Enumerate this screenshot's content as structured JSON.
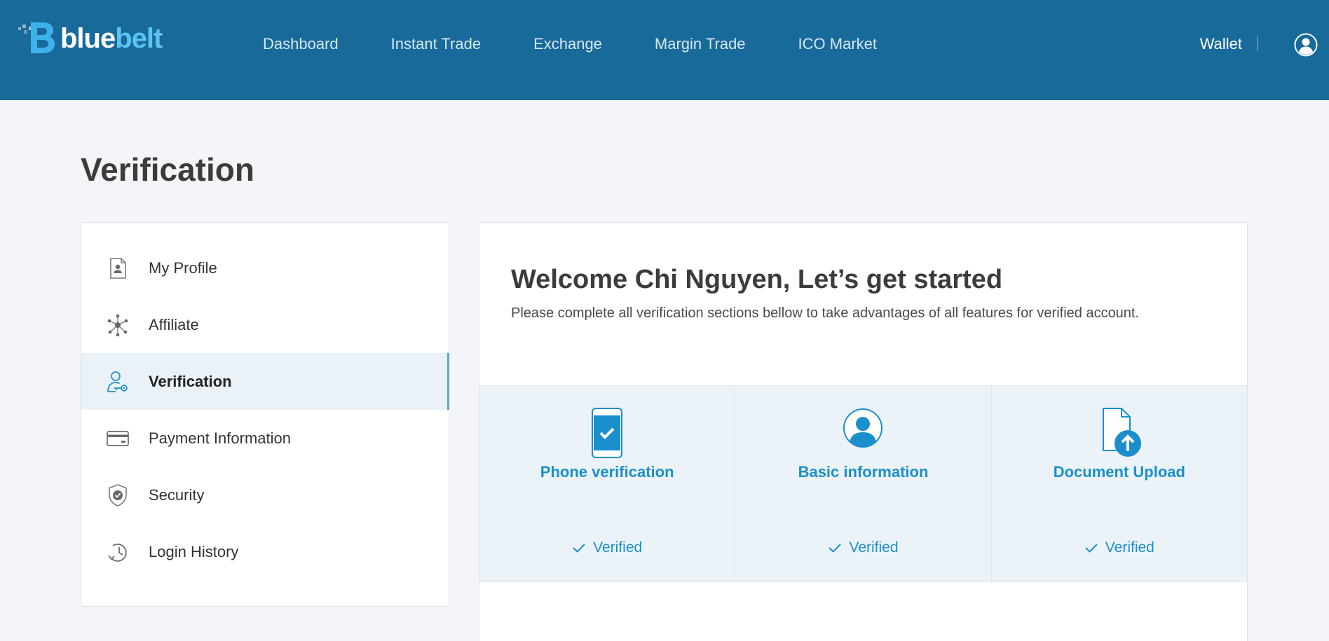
{
  "header": {
    "logo": {
      "word_white": "blue",
      "word_blue": "belt"
    },
    "nav": [
      {
        "label": "Dashboard"
      },
      {
        "label": "Instant Trade"
      },
      {
        "label": "Exchange"
      },
      {
        "label": "Margin Trade"
      },
      {
        "label": "ICO Market"
      }
    ],
    "wallet_label": "Wallet",
    "user_icon": "user-circle-icon"
  },
  "page_title": "Verification",
  "sidebar": {
    "items": [
      {
        "label": "My Profile",
        "icon": "profile-document-icon",
        "active": false
      },
      {
        "label": "Affiliate",
        "icon": "network-icon",
        "active": false
      },
      {
        "label": "Verification",
        "icon": "user-key-icon",
        "active": true
      },
      {
        "label": "Payment Information",
        "icon": "credit-card-icon",
        "active": false
      },
      {
        "label": "Security",
        "icon": "shield-check-icon",
        "active": false
      },
      {
        "label": "Login History",
        "icon": "history-clock-icon",
        "active": false
      }
    ]
  },
  "main": {
    "welcome": "Welcome Chi Nguyen, Let’s get started",
    "subtitle": "Please complete all verification sections bellow to take advantages of all features for verified account.",
    "steps": [
      {
        "title": "Phone verification",
        "status": "Verified",
        "icon": "phone-check-icon"
      },
      {
        "title": "Basic information",
        "status": "Verified",
        "icon": "user-avatar-icon"
      },
      {
        "title": "Document Upload",
        "status": "Verified",
        "icon": "document-upload-icon"
      }
    ]
  },
  "colors": {
    "header_bg": "#186a9a",
    "accent": "#1b8fcc",
    "page_bg": "#f4f5f9",
    "active_bg": "#eaf2f7",
    "step_bg": "#ebf3f8"
  }
}
